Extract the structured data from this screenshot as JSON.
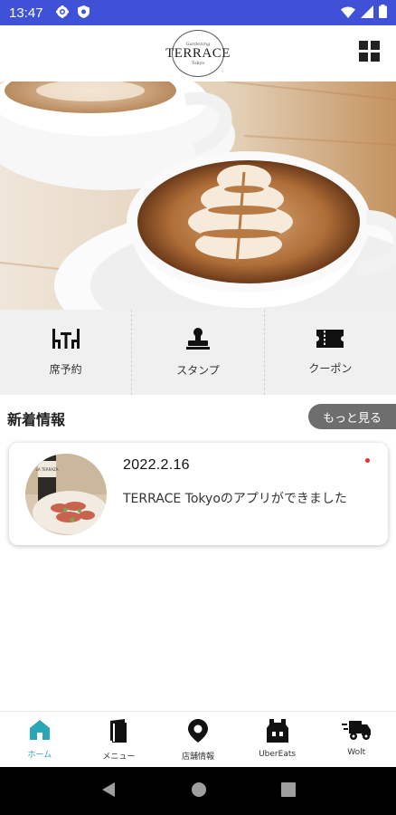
{
  "status_bar": {
    "time": "13:47",
    "icons_left": [
      "settings-icon",
      "shield-icon"
    ],
    "icons_right": [
      "wifi-icon",
      "signal-icon",
      "battery-icon"
    ]
  },
  "header": {
    "logo": {
      "small_text": "Gardening",
      "main_text": "TERRACE",
      "sub_text": "Tokyo"
    },
    "menu_icon": "grid-icon"
  },
  "hero": {
    "image": "latte-art-cups-photo"
  },
  "actions": [
    {
      "label": "席予約",
      "icon": "table-icon"
    },
    {
      "label": "スタンプ",
      "icon": "stamp-icon"
    },
    {
      "label": "クーポン",
      "icon": "ticket-icon"
    }
  ],
  "news": {
    "title": "新着情報",
    "more_label": "もっと見る",
    "items": [
      {
        "date": "2022.2.16",
        "text": "TERRACE Tokyoのアプリができました",
        "unread": true,
        "thumb_label": "LA TERRAZA",
        "thumb": "food-and-wine-photo"
      }
    ]
  },
  "bottom_nav": [
    {
      "label": "ホーム",
      "icon": "home-icon",
      "active": true
    },
    {
      "label": "メニュー",
      "icon": "book-icon",
      "active": false
    },
    {
      "label": "店舗情報",
      "icon": "location-pin-icon",
      "active": false
    },
    {
      "label": "UberEats",
      "icon": "delivery-bag-icon",
      "active": false
    },
    {
      "label": "Wolt",
      "icon": "delivery-truck-icon",
      "active": false
    }
  ],
  "system_nav": [
    "back-icon",
    "home-circle-icon",
    "recents-icon"
  ],
  "colors": {
    "status_bar": "#3f51d6",
    "accent": "#2aa6b4",
    "more_button": "#6e6e6e",
    "unread_dot": "#e53030"
  }
}
